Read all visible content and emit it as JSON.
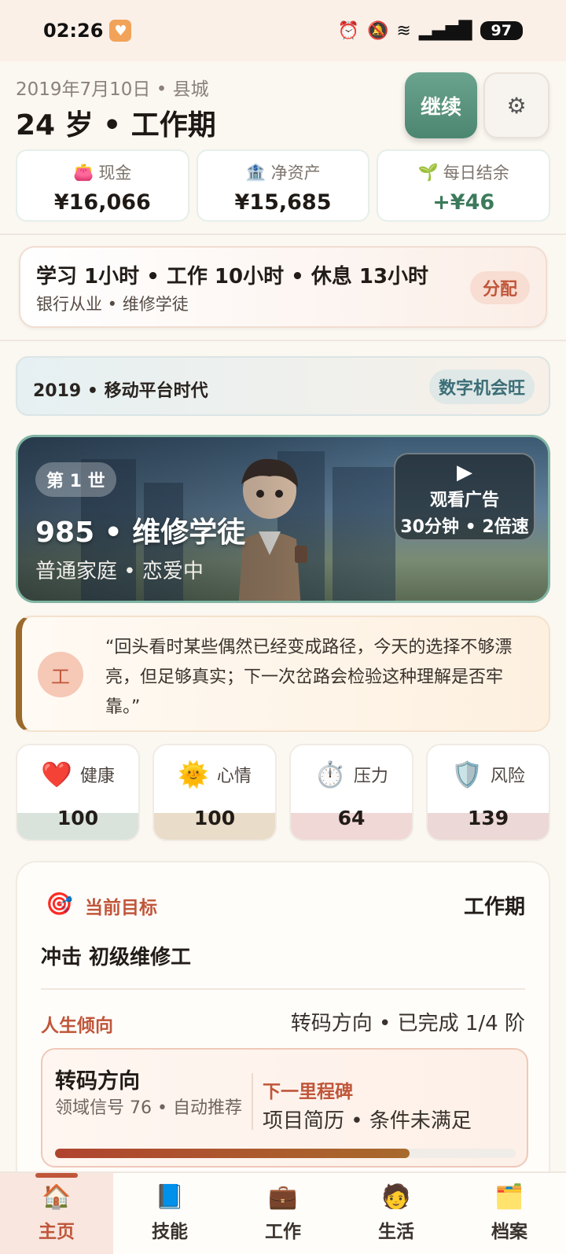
{
  "status_bar": {
    "time": "02:26",
    "battery": "97"
  },
  "header": {
    "date_location": "2019年7月10日 • 县城",
    "title": "24 岁 • 工作期",
    "continue_label": "继续",
    "settings_icon": "gear-icon"
  },
  "stats": [
    {
      "label": "现金",
      "value": "¥16,066",
      "icon": "wallet-icon"
    },
    {
      "label": "净资产",
      "value": "¥15,685",
      "icon": "bank-icon"
    },
    {
      "label": "每日结余",
      "value": "+¥46",
      "icon": "sprout-icon",
      "color": "#3c7a5b"
    }
  ],
  "allocation": {
    "hours": "学习 1小时 • 工作 10小时 • 休息 13小时",
    "roles": "银行从业 • 维修学徒",
    "button": "分配"
  },
  "era": {
    "text": "2019 • 移动平台时代",
    "badge": "数字机会旺"
  },
  "hero": {
    "life_badge": "第 1 世",
    "title": "985 • 维修学徒",
    "subtitle": "普通家庭 • 恋爱中",
    "ad_line1": "观看广告",
    "ad_line2": "30分钟 • 2倍速"
  },
  "quote": {
    "avatar_char": "工",
    "text": "“回头看时某些偶然已经变成路径，今天的选择不够漂亮，但足够真实；下一次岔路会检验这种理解是否牢靠。”"
  },
  "metrics": [
    {
      "label": "健康",
      "value": "100",
      "icon": "heart-icon",
      "color": "#d9e3dc"
    },
    {
      "label": "心情",
      "value": "100",
      "icon": "sun-icon",
      "color": "#e9dcc8"
    },
    {
      "label": "压力",
      "value": "64",
      "icon": "stopwatch-icon",
      "color": "#efd8d5"
    },
    {
      "label": "风险",
      "value": "139",
      "icon": "shield-icon",
      "color": "#ecd8d6"
    }
  ],
  "goal": {
    "title": "当前目标",
    "stage": "工作期",
    "target": "冲击 初级维修工",
    "trend_title": "人生倾向",
    "trend_status": "转码方向 • 已完成 1/4 阶",
    "direction_title": "转码方向",
    "direction_sub": "领域信号 76 • 自动推荐",
    "milestone_title": "下一里程碑",
    "milestone_text": "项目简历 • 条件未满足",
    "progress": 0.77
  },
  "nav": [
    {
      "label": "主页",
      "icon": "home-icon",
      "active": true
    },
    {
      "label": "技能",
      "icon": "book-icon",
      "active": false
    },
    {
      "label": "工作",
      "icon": "briefcase-icon",
      "active": false
    },
    {
      "label": "生活",
      "icon": "person-icon",
      "active": false
    },
    {
      "label": "档案",
      "icon": "archive-icon",
      "active": false
    }
  ]
}
